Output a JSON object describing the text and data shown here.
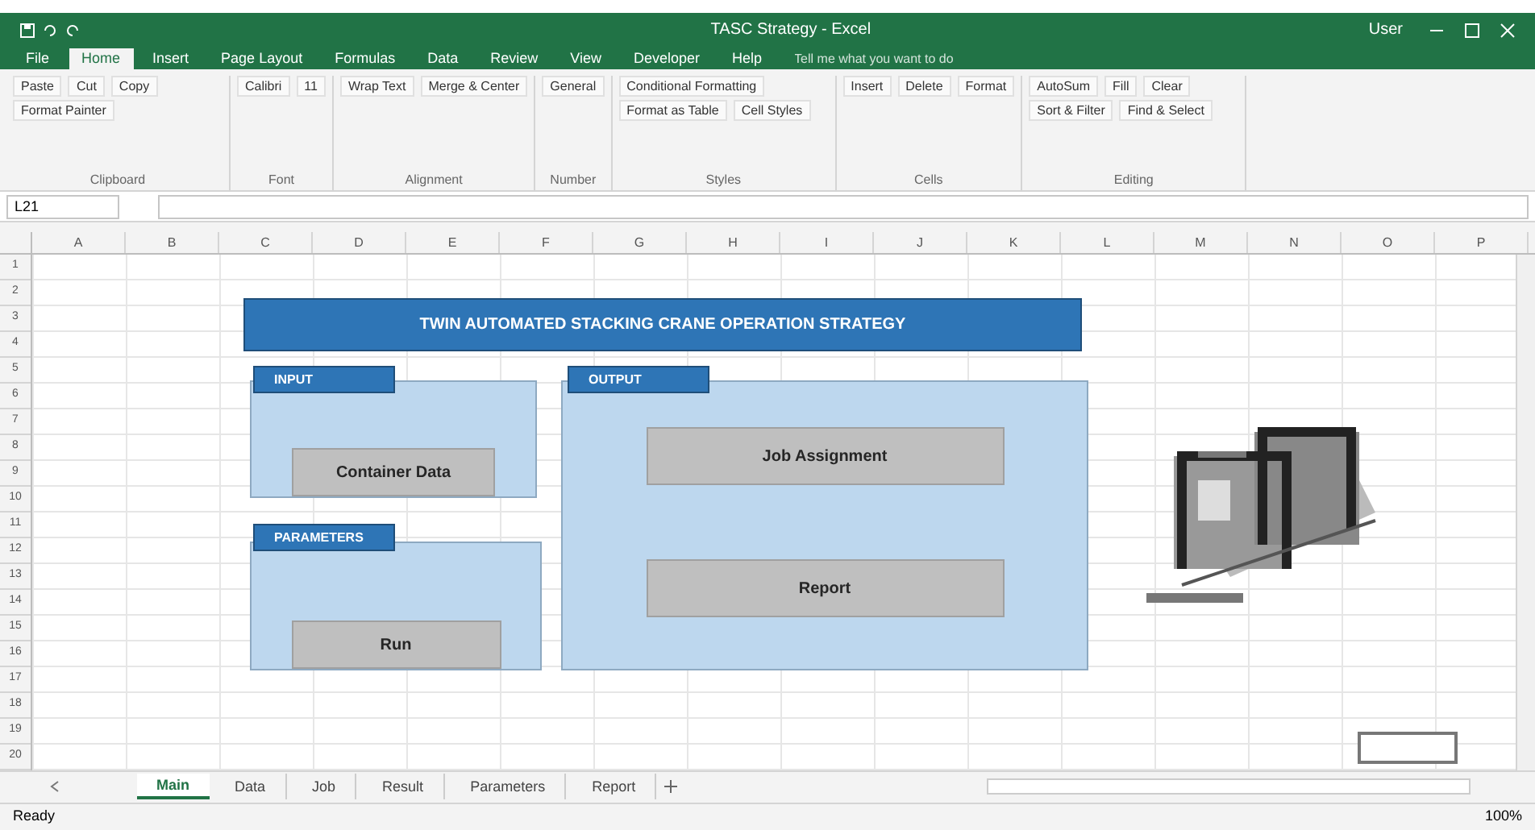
{
  "window": {
    "title": "TASC Strategy - Excel",
    "user": "User"
  },
  "ribbon_tabs": [
    {
      "label": "File",
      "selected": false
    },
    {
      "label": "Home",
      "selected": true
    },
    {
      "label": "Insert",
      "selected": false
    },
    {
      "label": "Page Layout",
      "selected": false
    },
    {
      "label": "Formulas",
      "selected": false
    },
    {
      "label": "Data",
      "selected": false
    },
    {
      "label": "Review",
      "selected": false
    },
    {
      "label": "View",
      "selected": false
    },
    {
      "label": "Developer",
      "selected": false
    },
    {
      "label": "Help",
      "selected": false
    }
  ],
  "tell_me": {
    "placeholder": "Tell me what you want to do"
  },
  "ribbon_groups": [
    {
      "label": "Clipboard",
      "buttons": [
        "Paste",
        "Cut",
        "Copy",
        "Format Painter"
      ]
    },
    {
      "label": "Font",
      "buttons": [
        "Calibri",
        "11"
      ]
    },
    {
      "label": "Alignment",
      "buttons": [
        "Wrap Text",
        "Merge & Center"
      ]
    },
    {
      "label": "Number",
      "buttons": [
        "General"
      ]
    },
    {
      "label": "Styles",
      "buttons": [
        "Conditional Formatting",
        "Format as Table",
        "Cell Styles"
      ]
    },
    {
      "label": "Cells",
      "buttons": [
        "Insert",
        "Delete",
        "Format"
      ]
    },
    {
      "label": "Editing",
      "buttons": [
        "AutoSum",
        "Fill",
        "Clear",
        "Sort & Filter",
        "Find & Select"
      ]
    }
  ],
  "name_box": "L21",
  "columns": [
    "A",
    "B",
    "C",
    "D",
    "E",
    "F",
    "G",
    "H",
    "I",
    "J",
    "K",
    "L",
    "M",
    "N",
    "O",
    "P"
  ],
  "rows": [
    "1",
    "2",
    "3",
    "4",
    "5",
    "6",
    "7",
    "8",
    "9",
    "10",
    "11",
    "12",
    "13",
    "14",
    "15",
    "16",
    "17",
    "18",
    "19",
    "20"
  ],
  "dashboard": {
    "title": "TWIN AUTOMATED STACKING CRANE OPERATION STRATEGY",
    "panels": [
      {
        "label": "INPUT",
        "buttons": [
          "Container Data"
        ]
      },
      {
        "label": "PARAMETERS",
        "buttons": [
          "Run"
        ]
      },
      {
        "label": "OUTPUT",
        "buttons": [
          "Job Assignment",
          "Report"
        ]
      }
    ]
  },
  "sheet_tabs": [
    {
      "label": "Main",
      "selected": true
    },
    {
      "label": "Data",
      "selected": false
    },
    {
      "label": "Job",
      "selected": false
    },
    {
      "label": "Result",
      "selected": false
    },
    {
      "label": "Parameters",
      "selected": false
    },
    {
      "label": "Report",
      "selected": false
    }
  ],
  "status": {
    "text": "Ready",
    "zoom": "100%"
  }
}
